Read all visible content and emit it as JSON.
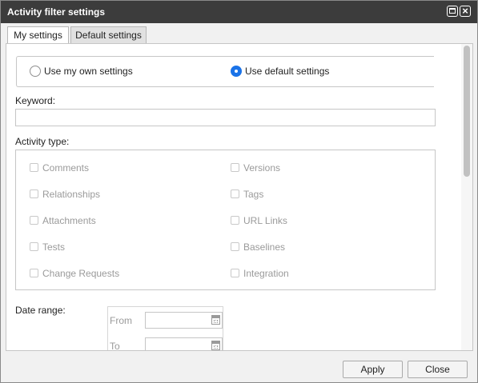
{
  "window": {
    "title": "Activity filter settings"
  },
  "tabs": [
    {
      "label": "My settings"
    },
    {
      "label": "Default settings"
    }
  ],
  "mode": {
    "options": [
      {
        "label": "Use my own settings",
        "selected": false
      },
      {
        "label": "Use default settings",
        "selected": true
      }
    ]
  },
  "keyword": {
    "label": "Keyword:",
    "value": ""
  },
  "activity_type": {
    "label": "Activity type:",
    "left_items": [
      {
        "label": "Comments",
        "checked": false
      },
      {
        "label": "Relationships",
        "checked": false
      },
      {
        "label": "Attachments",
        "checked": false
      },
      {
        "label": "Tests",
        "checked": false
      },
      {
        "label": "Change Requests",
        "checked": false
      }
    ],
    "right_items": [
      {
        "label": "Versions",
        "checked": false
      },
      {
        "label": "Tags",
        "checked": false
      },
      {
        "label": "URL Links",
        "checked": false
      },
      {
        "label": "Baselines",
        "checked": false
      },
      {
        "label": "Integration",
        "checked": false
      }
    ]
  },
  "date_range": {
    "label": "Date range:",
    "from_label": "From",
    "to_label": "To",
    "from_value": "",
    "to_value": ""
  },
  "footer": {
    "apply_label": "Apply",
    "close_label": "Close"
  },
  "colors": {
    "titlebar": "#3c3c3c",
    "accent": "#1a73e8"
  }
}
